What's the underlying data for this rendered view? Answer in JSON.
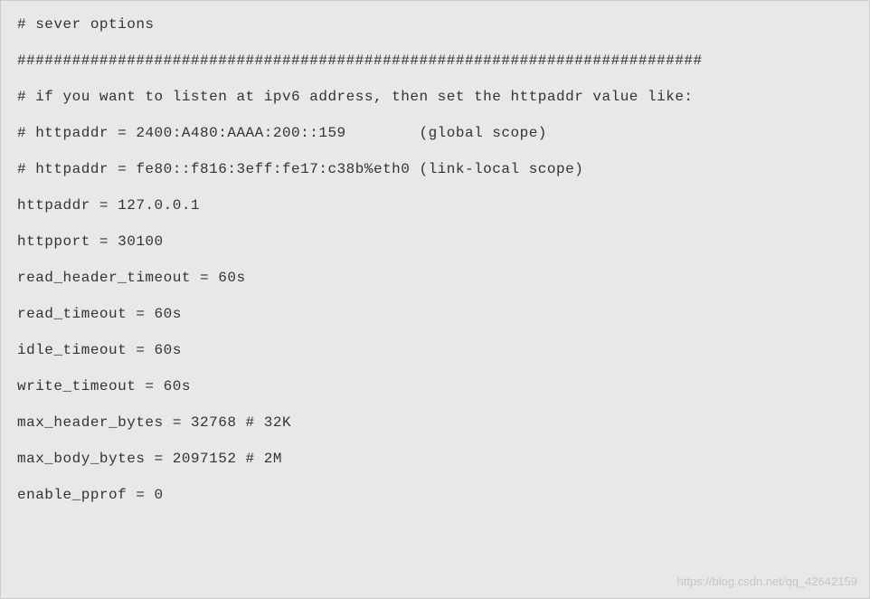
{
  "code": {
    "lines": [
      "# sever options",
      "###########################################################################",
      "# if you want to listen at ipv6 address, then set the httpaddr value like:",
      "# httpaddr = 2400:A480:AAAA:200::159        (global scope)",
      "# httpaddr = fe80::f816:3eff:fe17:c38b%eth0 (link-local scope)",
      "httpaddr = 127.0.0.1",
      "httpport = 30100",
      "",
      "read_header_timeout = 60s",
      "read_timeout = 60s",
      "idle_timeout = 60s",
      "write_timeout = 60s",
      "max_header_bytes = 32768 # 32K",
      "max_body_bytes = 2097152 # 2M",
      "",
      "enable_pprof = 0"
    ]
  },
  "watermark": "https://blog.csdn.net/qq_42642159"
}
